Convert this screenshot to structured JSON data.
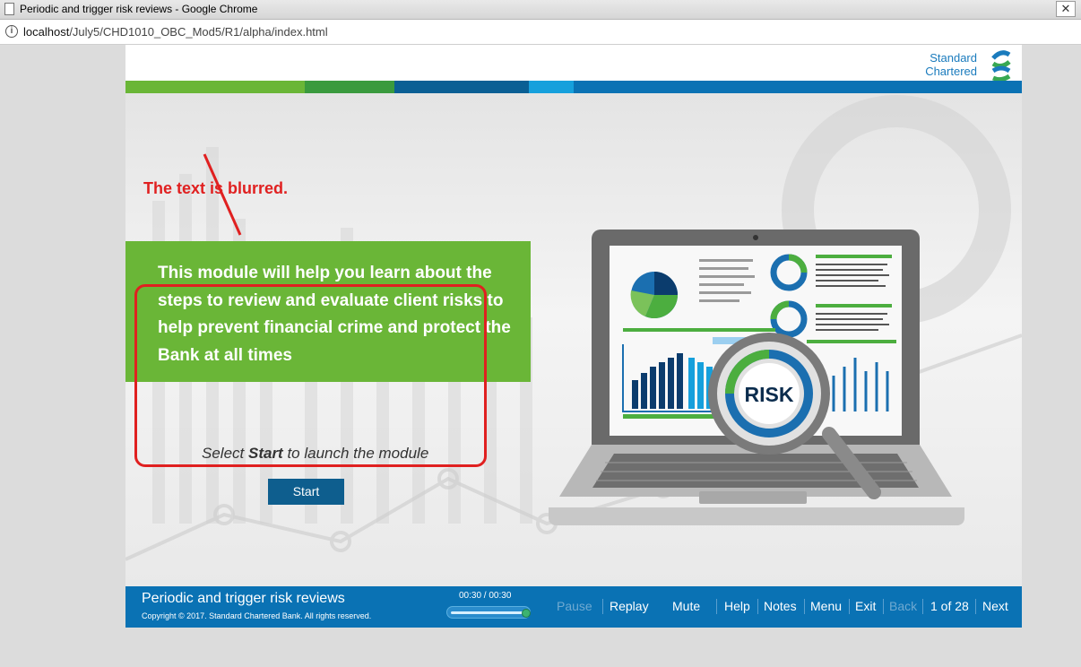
{
  "browser": {
    "window_title": "Periodic and trigger risk reviews - Google Chrome",
    "url_host": "localhost",
    "url_path": "/July5/CHD1010_OBC_Mod5/R1/alpha/index.html"
  },
  "header": {
    "logo_text": "Standard\nChartered"
  },
  "main": {
    "intro_text": "This module will help you learn about the steps to review and evaluate client risks to help prevent financial crime and protect the Bank at all times",
    "select_prefix": "Select ",
    "select_bold": "Start",
    "select_suffix": " to launch the module",
    "start_label": "Start",
    "risk_label": "RISK"
  },
  "annotation": {
    "text": "The text is blurred."
  },
  "footer": {
    "course_title": "Periodic and trigger risk reviews",
    "copyright": "Copyright © 2017. Standard Chartered Bank. All rights reserved.",
    "timecode": "00:30 / 00:30",
    "progress": 1.0,
    "nav": {
      "pause": "Pause",
      "replay": "Replay",
      "mute": "Mute",
      "help": "Help",
      "notes": "Notes",
      "menu": "Menu",
      "exit": "Exit",
      "back": "Back",
      "page": "1 of 28",
      "next": "Next"
    }
  },
  "colors": {
    "brand_green": "#6ab637",
    "brand_blue": "#0a72b4",
    "annotation_red": "#e02020",
    "start_button": "#0e5e8e"
  }
}
